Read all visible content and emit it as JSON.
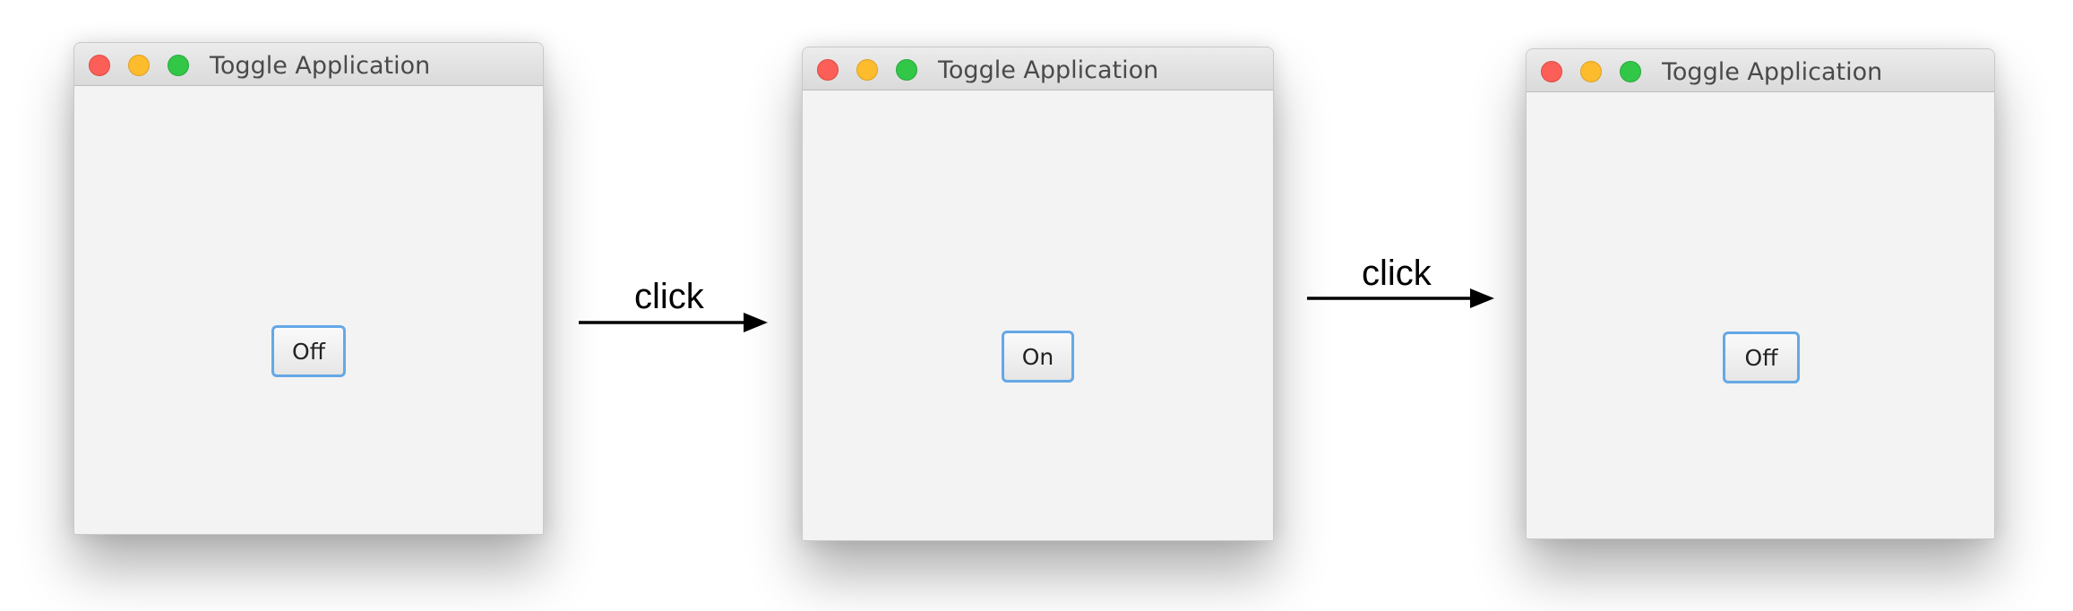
{
  "windows": [
    {
      "title": "Toggle Application",
      "button_label": "Off",
      "traffic_lights": {
        "close": "#fc5f57",
        "minimize": "#fdbc2e",
        "maximize": "#33c748"
      }
    },
    {
      "title": "Toggle Application",
      "button_label": "On",
      "traffic_lights": {
        "close": "#fc5f57",
        "minimize": "#fdbc2e",
        "maximize": "#33c748"
      }
    },
    {
      "title": "Toggle Application",
      "button_label": "Off",
      "traffic_lights": {
        "close": "#fc5f57",
        "minimize": "#fdbc2e",
        "maximize": "#33c748"
      }
    }
  ],
  "transitions": [
    {
      "label": "click",
      "icon": "right-arrow-icon"
    },
    {
      "label": "click",
      "icon": "right-arrow-icon"
    }
  ],
  "colors": {
    "window_background": "#f3f3f3",
    "button_focus_border": "#65a8e6",
    "arrow": "#000000"
  }
}
